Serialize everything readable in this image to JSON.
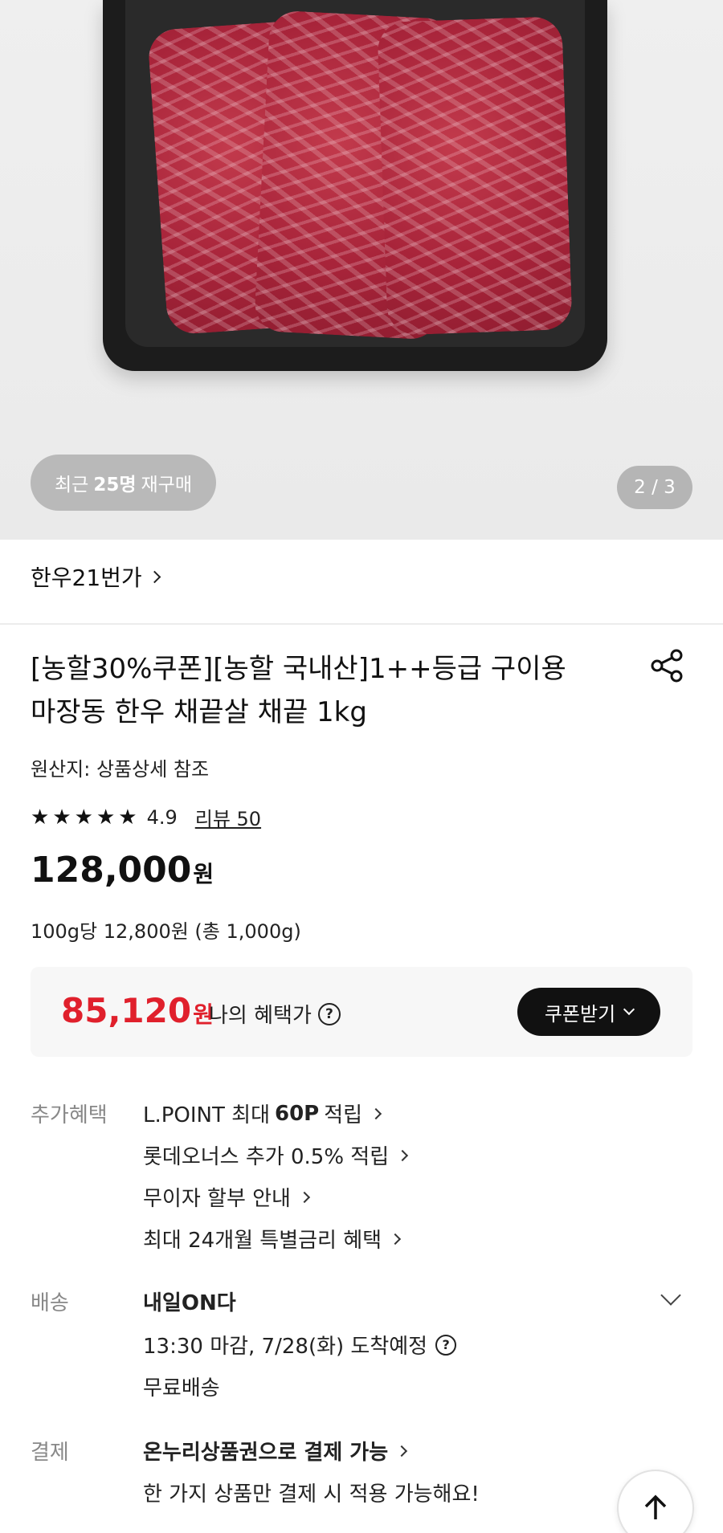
{
  "gallery": {
    "rebuy_prefix": "최근",
    "rebuy_count": "25명",
    "rebuy_suffix": "재구매",
    "page_indicator": "2 / 3"
  },
  "store": {
    "name": "한우21번가"
  },
  "product": {
    "title_line1": "[농할30%쿠폰][농할 국내산]1++등급 구이용",
    "title_line2": "마장동 한우 채끝살 채끝 1kg",
    "origin": "원산지: 상품상세 참조",
    "rating": "4.9",
    "rating_stars": 5,
    "review_link": "리뷰 50",
    "price": "128,000",
    "price_unit": "원",
    "unit_price": "100g당 12,800원 (총 1,000g)"
  },
  "benefit": {
    "price": "85,120",
    "price_unit": "원",
    "label": "나의 혜택가",
    "coupon_button": "쿠폰받기",
    "accent_color": "#e0202c"
  },
  "extra_benefits": {
    "label": "추가혜택",
    "line1_prefix": "L.POINT 최대",
    "line1_bold": "60P",
    "line1_suffix": "적립",
    "line2": "롯데오너스 추가 0.5% 적립",
    "line3": "무이자 할부 안내",
    "line4": "최대 24개월 특별금리 혜택"
  },
  "shipping": {
    "label": "배송",
    "title": "내일ON다",
    "eta": "13:30 마감, 7/28(화) 도착예정",
    "fee": "무료배송"
  },
  "payment": {
    "label": "결제",
    "line1": "온누리상품권으로 결제 가능",
    "line2": "한 가지 상품만 결제 시 적용 가능해요!"
  },
  "icons": {
    "share": "share-icon",
    "help": "question-circle-icon",
    "scroll_top": "arrow-up-icon"
  }
}
